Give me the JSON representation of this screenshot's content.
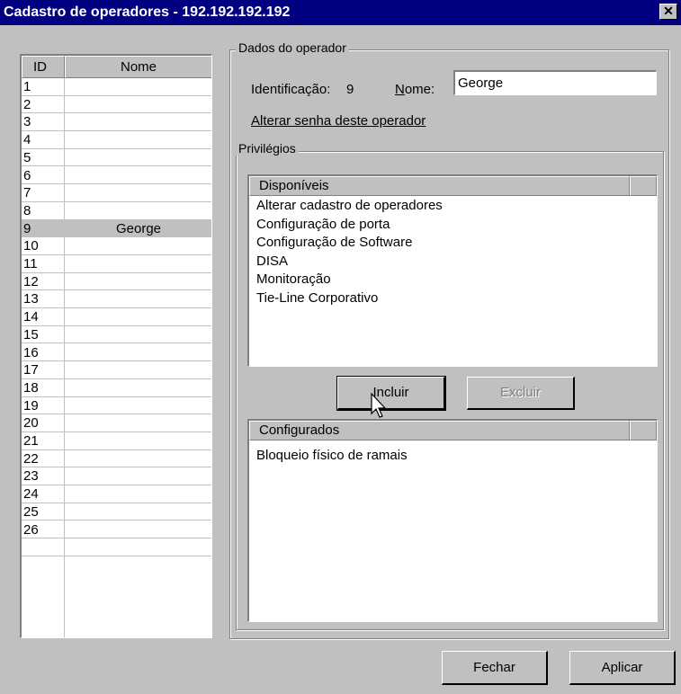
{
  "window": {
    "title": "Cadastro de operadores - 192.192.192.192",
    "close_glyph": "✕"
  },
  "operator_list": {
    "headers": {
      "id": "ID",
      "nome": "Nome"
    },
    "rows": [
      {
        "id": "1",
        "nome": ""
      },
      {
        "id": "2",
        "nome": ""
      },
      {
        "id": "3",
        "nome": ""
      },
      {
        "id": "4",
        "nome": ""
      },
      {
        "id": "5",
        "nome": ""
      },
      {
        "id": "6",
        "nome": ""
      },
      {
        "id": "7",
        "nome": ""
      },
      {
        "id": "8",
        "nome": ""
      },
      {
        "id": "9",
        "nome": "George"
      },
      {
        "id": "10",
        "nome": ""
      },
      {
        "id": "11",
        "nome": ""
      },
      {
        "id": "12",
        "nome": ""
      },
      {
        "id": "13",
        "nome": ""
      },
      {
        "id": "14",
        "nome": ""
      },
      {
        "id": "15",
        "nome": ""
      },
      {
        "id": "16",
        "nome": ""
      },
      {
        "id": "17",
        "nome": ""
      },
      {
        "id": "18",
        "nome": ""
      },
      {
        "id": "19",
        "nome": ""
      },
      {
        "id": "20",
        "nome": ""
      },
      {
        "id": "21",
        "nome": ""
      },
      {
        "id": "22",
        "nome": ""
      },
      {
        "id": "23",
        "nome": ""
      },
      {
        "id": "24",
        "nome": ""
      },
      {
        "id": "25",
        "nome": ""
      },
      {
        "id": "26",
        "nome": ""
      },
      {
        "id": "",
        "nome": ""
      }
    ],
    "selected_id": "9"
  },
  "operator_data": {
    "group_label": "Dados do operador",
    "identificacao_label": "Identificação:",
    "identificacao_value": "9",
    "nome_label": "Nome:",
    "nome_value": "George",
    "change_password_link": "Alterar senha deste operador"
  },
  "privileges": {
    "group_label": "Privilégios",
    "available_header": "Disponíveis",
    "available": [
      "Alterar cadastro de operadores",
      "Configuração de porta",
      "Configuração de Software",
      "DISA",
      "Monitoração",
      "Tie-Line Corporativo"
    ],
    "include_button": "Incluir",
    "exclude_button": "Excluir",
    "configured_header": "Configurados",
    "configured": [
      "Bloqueio físico de ramais"
    ]
  },
  "footer": {
    "close_button": "Fechar",
    "apply_button": "Aplicar"
  }
}
